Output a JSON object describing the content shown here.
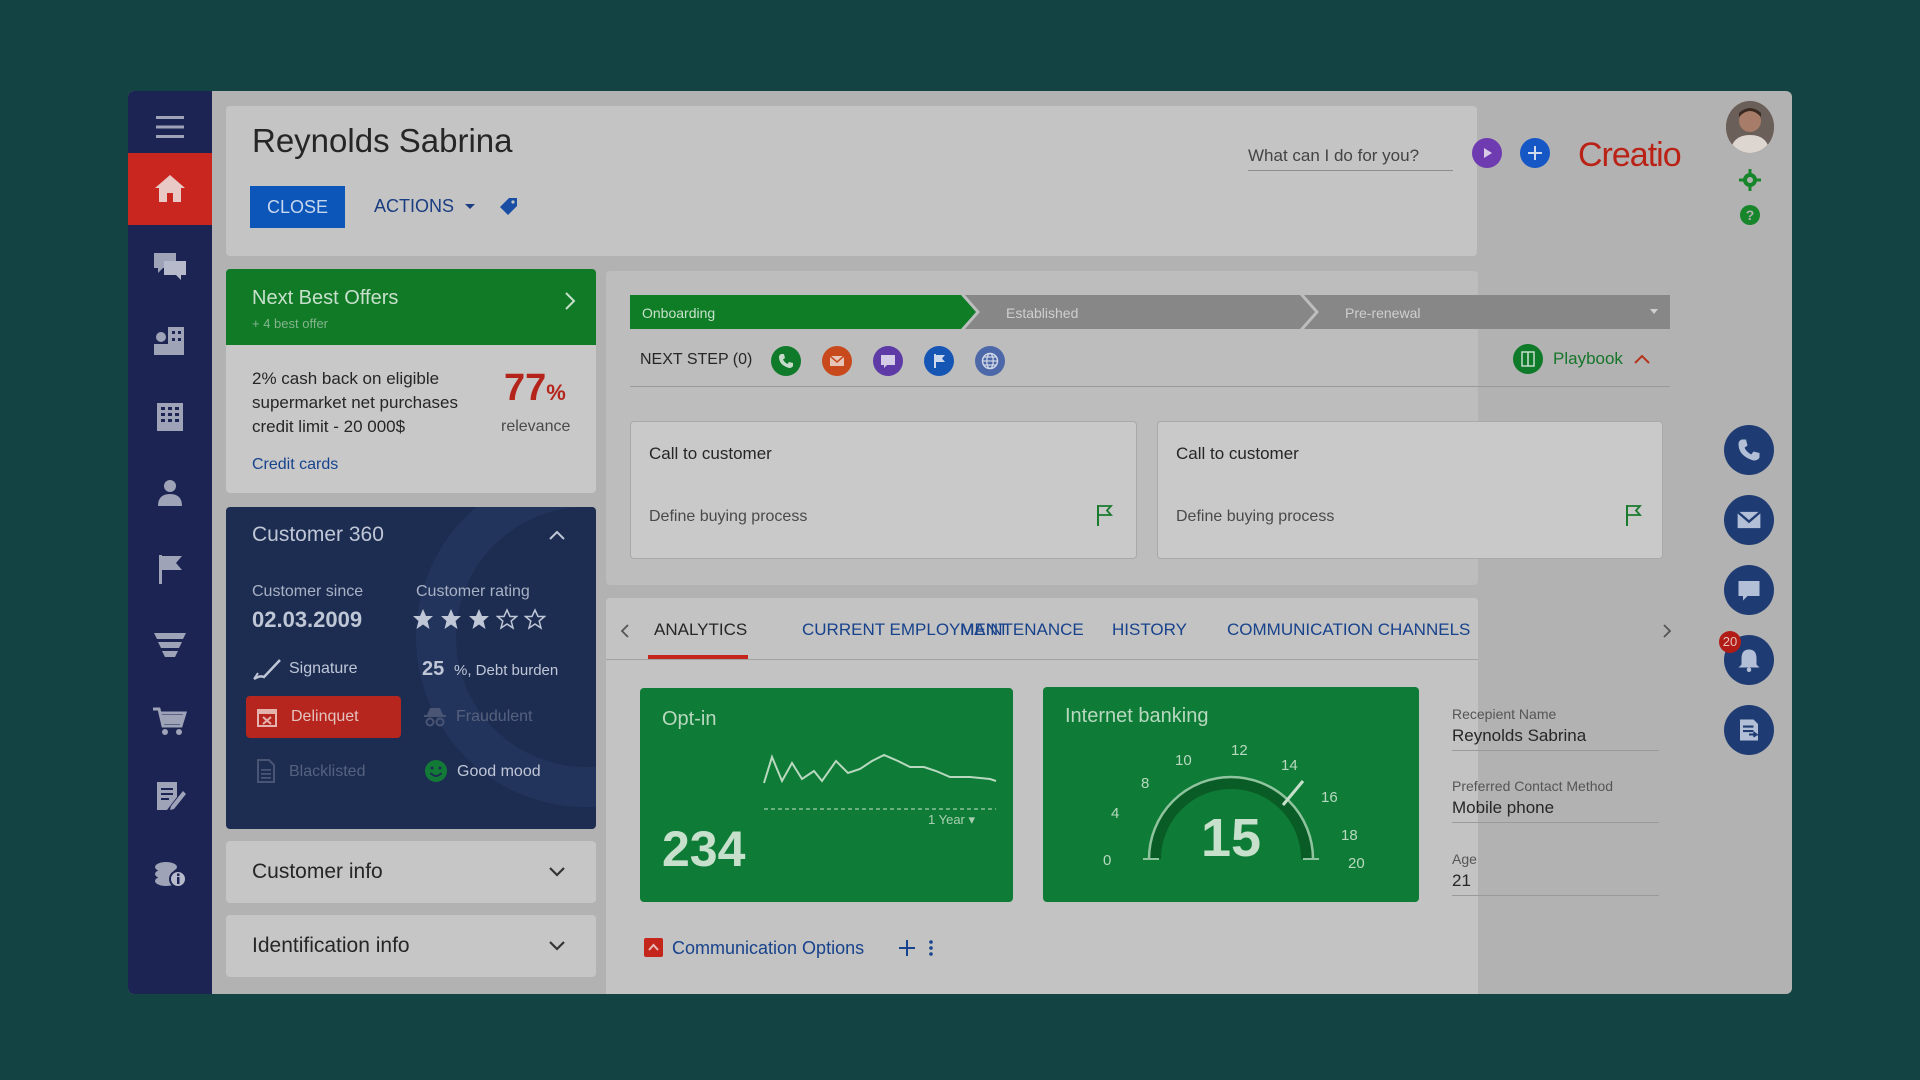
{
  "header": {
    "title": "Reynolds Sabrina",
    "close_label": "CLOSE",
    "actions_label": "ACTIONS",
    "search_placeholder": "What can I do for you?",
    "logo_text": "Creatio"
  },
  "nav": {
    "items": [
      "menu-icon",
      "home-icon",
      "chat-icon",
      "accounts-icon",
      "building-icon",
      "contact-icon",
      "flag-icon",
      "funnel-icon",
      "cart-icon",
      "document-edit-icon",
      "coins-icon"
    ]
  },
  "nbo": {
    "title": "Next Best Offers",
    "subtitle": "+ 4 best offer",
    "offer_line1": "2% cash back on eligible",
    "offer_line2": "supermarket net purchases",
    "offer_line3": "credit limit - 20 000$",
    "percent": "77",
    "percent_sign": "%",
    "relevance_label": "relevance",
    "link": "Credit cards"
  },
  "c360": {
    "title": "Customer 360",
    "since_label": "Customer since",
    "since_value": "02.03.2009",
    "rating_label": "Customer rating",
    "rating": 3,
    "rating_max": 5,
    "signature": "Signature",
    "debt_value": "25",
    "debt_label": "%, Debt burden",
    "delinquent": "Delinquet",
    "fraudulent": "Fraudulent",
    "blacklisted": "Blacklisted",
    "good_mood": "Good mood"
  },
  "panels": {
    "customer_info": "Customer info",
    "identification_info": "Identification info"
  },
  "stages": {
    "items": [
      "Onboarding",
      "Established",
      "Pre-renewal"
    ],
    "next_step": "NEXT STEP (0)",
    "playbook": "Playbook"
  },
  "cards": [
    {
      "title": "Call to customer",
      "subtitle": "Define buying process"
    },
    {
      "title": "Call to customer",
      "subtitle": "Define buying process"
    }
  ],
  "tabs": [
    "ANALYTICS",
    "CURRENT EMPLOYMENT",
    "MAINTENANCE",
    "HISTORY",
    "COMMUNICATION CHANNELS"
  ],
  "optin": {
    "title": "Opt-in",
    "value": "234",
    "period": "1 Year"
  },
  "internet_banking": {
    "title": "Internet banking",
    "value": "15",
    "ticks": [
      "0",
      "4",
      "8",
      "10",
      "12",
      "14",
      "16",
      "18",
      "20"
    ]
  },
  "details": {
    "recipient_label": "Recepient Name",
    "recipient_value": "Reynolds Sabrina",
    "contact_label": "Preferred Contact Method",
    "contact_value": "Mobile phone",
    "age_label": "Age",
    "age_value": "21"
  },
  "comm_options": "Communication Options",
  "notifications_count": "20",
  "colors": {
    "nav_bg": "#1b2452",
    "active": "#c9261f",
    "green": "#117a27",
    "link": "#17428c"
  }
}
